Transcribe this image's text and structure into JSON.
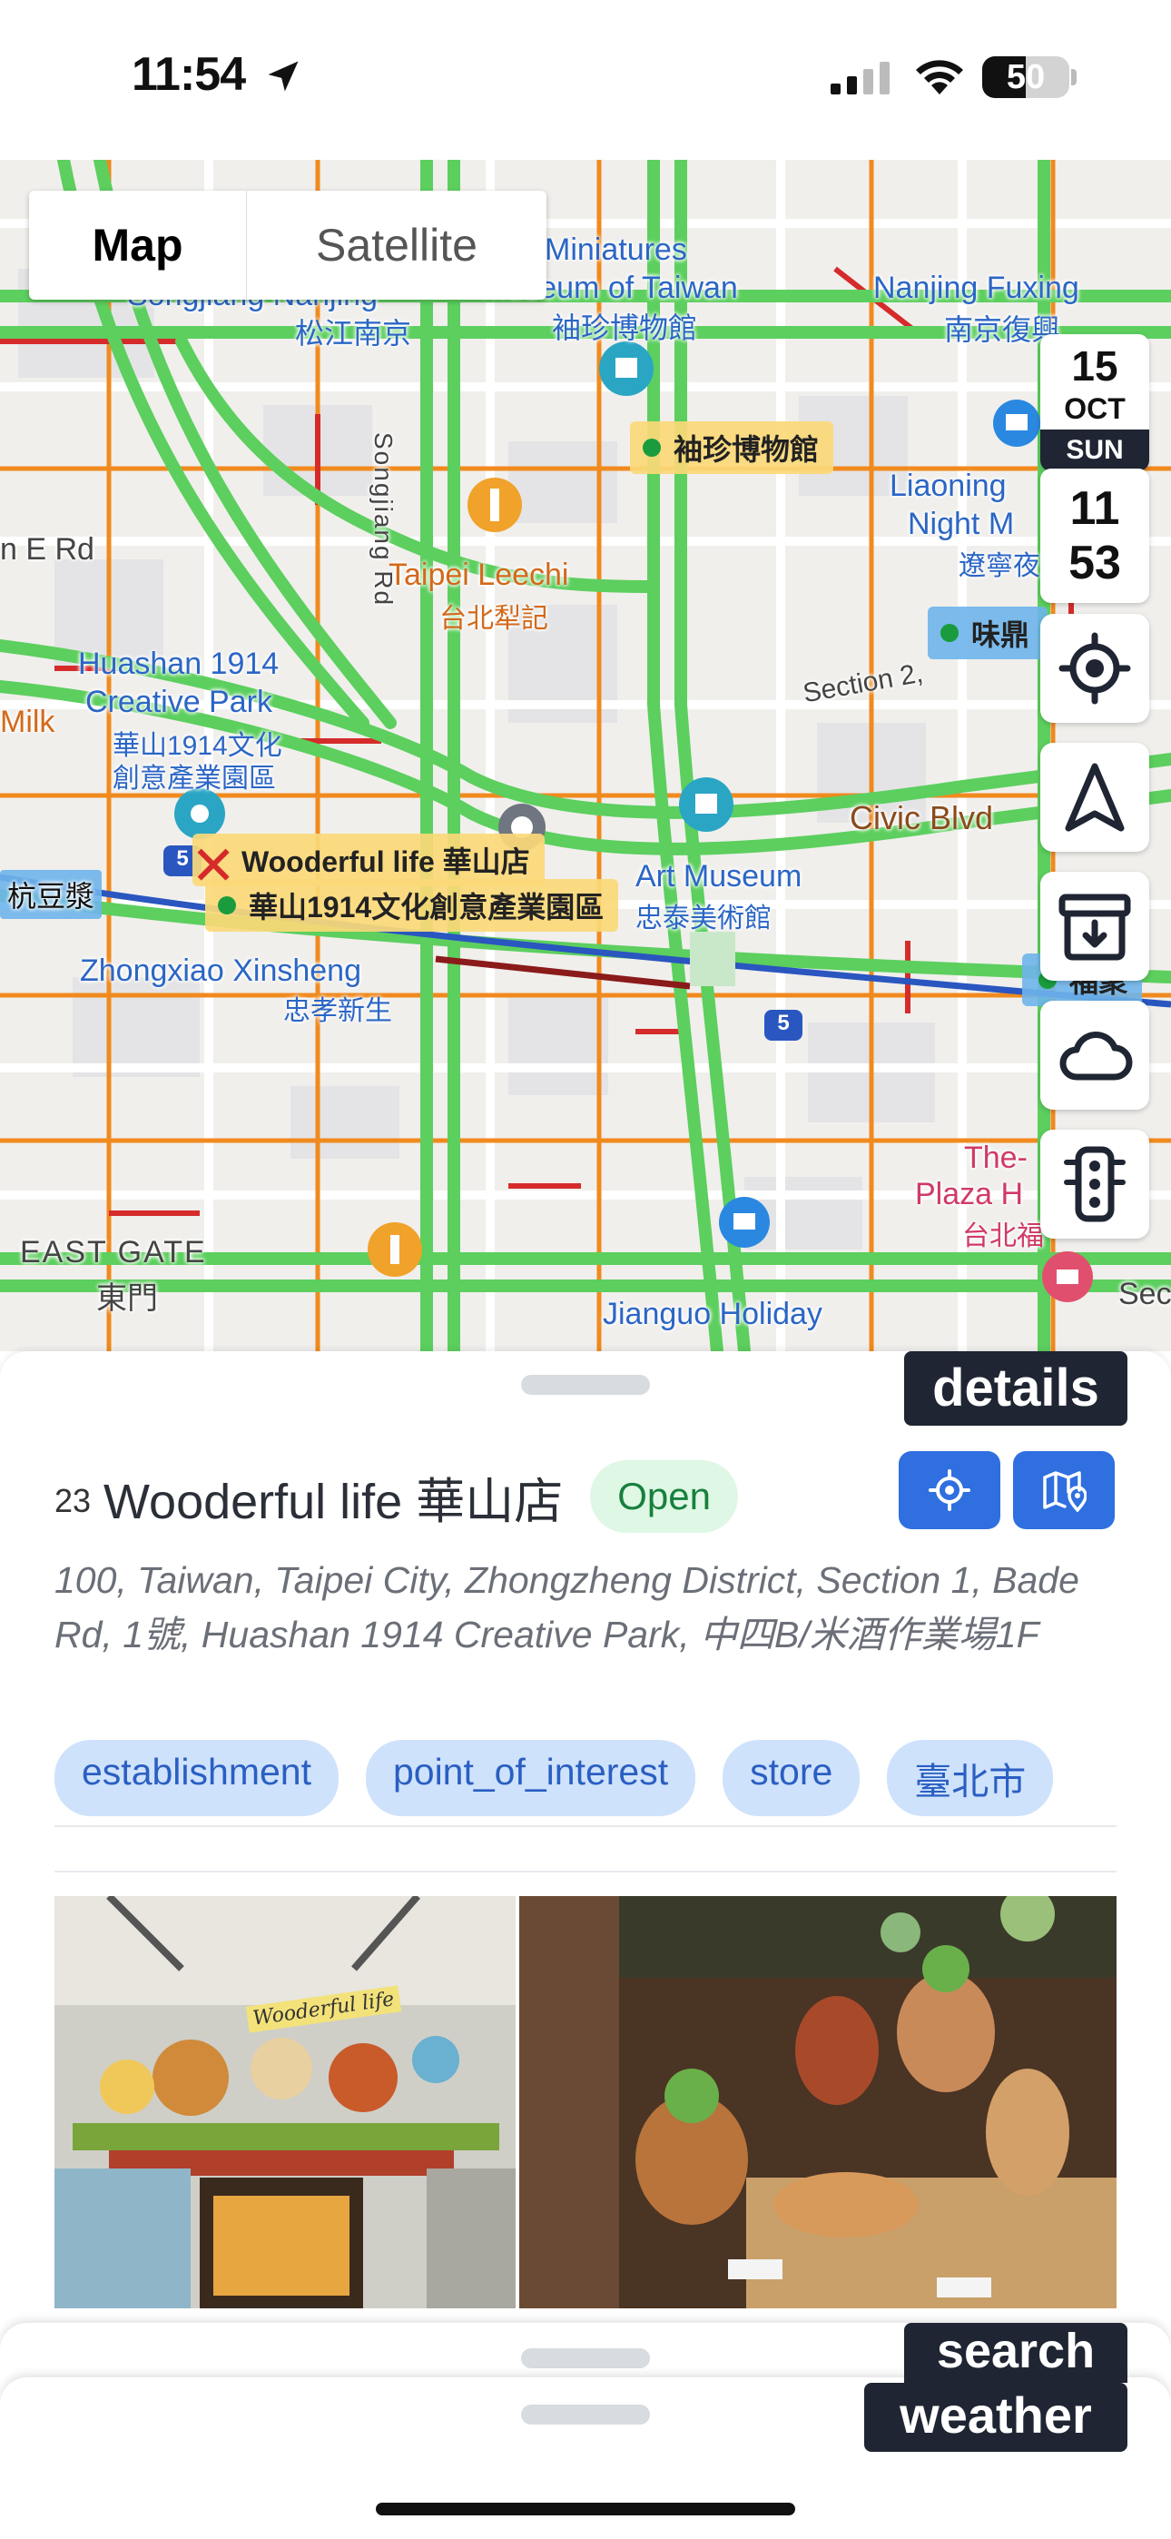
{
  "status_bar": {
    "time": "11:54",
    "battery_percent": "50",
    "battery_level": 0.5,
    "icons": [
      "location-arrow-icon",
      "cellular-signal-icon",
      "wifi-icon",
      "battery-icon"
    ]
  },
  "map": {
    "toggle": {
      "map_label": "Map",
      "satellite_label": "Satellite",
      "selected": "Map"
    },
    "labels": {
      "miniatures": "Miniatures",
      "museum_of_taiwan": "Museum of Taiwan",
      "songjiang_nanjing": "Songjiang Nanjing",
      "songjiang_nanjing_zh": "松江南京",
      "miniatures_zh": "袖珍博物館",
      "nanjing_fuxing": "Nanjing Fuxing",
      "nanjing_fuxing_zh": "南京復興",
      "songjiang_rd": "Songjiang Rd",
      "taipei_leechi": "Taipei Leechi",
      "taipei_leechi_zh": "台北犁記",
      "liaoning": "Liaoning",
      "night_m": "Night M",
      "liaoning_zh": "遼寧夜",
      "e_rd": "n E Rd",
      "huashan_1": "Huashan 1914",
      "huashan_2": "Creative Park",
      "huashan_zh1": "華山1914文化",
      "huashan_zh2": "創意產業園區",
      "milk": "Milk",
      "section_2": "Section 2,",
      "civic_blvd": "Civic Blvd",
      "art_museum": "Art Museum",
      "art_museum_zh": "忠泰美術館",
      "zhongxiao": "Zhongxiao Xinsheng",
      "zhongxiao_zh": "忠孝新生",
      "soy_milk": "杭豆漿",
      "east_gate": "EAST GATE",
      "east_gate_zh": "東門",
      "jianguo": "Jianguo Holiday",
      "plaza_1": "The-",
      "plaza_2": "Plaza H",
      "plaza_zh": "台北福",
      "sec": "Sec",
      "route": "5"
    },
    "poi_tags": {
      "miniatures_tag": "袖珍博物館",
      "weiding_tag": "味鼎",
      "selected_place": "Wooderful life 華山店",
      "huashan_tag": "華山1914文化創意產業園區",
      "fuju_tag": "福聚"
    },
    "date_card": {
      "day": "15",
      "month": "OCT",
      "weekday": "SUN"
    },
    "time_card": {
      "hour": "11",
      "minute": "53"
    },
    "side_buttons": [
      "locate-icon",
      "navigation-arrow-icon",
      "archive-download-icon",
      "cloud-icon",
      "traffic-light-icon"
    ]
  },
  "details": {
    "chip_label": "details",
    "index": "23",
    "name": "Wooderful life 華山店",
    "status": "Open",
    "address": "100, Taiwan, Taipei City, Zhongzheng District, Section 1, Bade Rd, 1號, Huashan 1914 Creative Park, 中四B/米酒作業場1F",
    "tags": [
      "establishment",
      "point_of_interest",
      "store",
      "臺北市"
    ],
    "photo_sign_text": "Wooderful life",
    "action_buttons": [
      "center-on-map-icon",
      "map-pin-icon"
    ]
  },
  "bottom": {
    "search_label": "search",
    "weather_label": "weather"
  },
  "colors": {
    "traffic_green": "#5ccf5e",
    "traffic_orange": "#f08a1e",
    "traffic_red": "#d52b2b",
    "primary_blue": "#2f6fe0",
    "tag_bg": "#cfe2fb",
    "chip_dark": "#1f2532",
    "open_green": "#17803d"
  }
}
